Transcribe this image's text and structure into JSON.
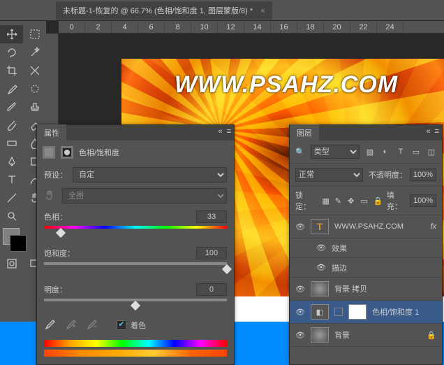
{
  "tabs": {
    "doc": "未标题-1-恢复的 @ 66.7% (色相/饱和度 1, 图层蒙版/8) *"
  },
  "ruler": [
    "0",
    "2",
    "4",
    "6",
    "8",
    "10",
    "12",
    "14",
    "16",
    "18",
    "20",
    "22",
    "24"
  ],
  "canvas": {
    "text": "WWW.PSAHZ.COM"
  },
  "props": {
    "title": "属性",
    "adjustment": "色相/饱和度",
    "preset_label": "预设：",
    "preset_value": "自定",
    "range_value": "全图",
    "hue_label": "色相：",
    "hue_value": "33",
    "sat_label": "饱和度：",
    "sat_value": "100",
    "light_label": "明度：",
    "light_value": "0",
    "colorize": "着色"
  },
  "layers": {
    "title": "图层",
    "kind": "类型",
    "blend": "正常",
    "opacity_label": "不透明度：",
    "opacity": "100%",
    "lock_label": "锁定：",
    "fill_label": "填充：",
    "fill": "100%",
    "items": {
      "text_layer": "WWW.PSAHZ.COM",
      "effects": "效果",
      "stroke": "描边",
      "bg_copy": "背景 拷贝",
      "hue_sat": "色相/饱和度 1",
      "bg": "背景"
    },
    "fx": "fx"
  }
}
